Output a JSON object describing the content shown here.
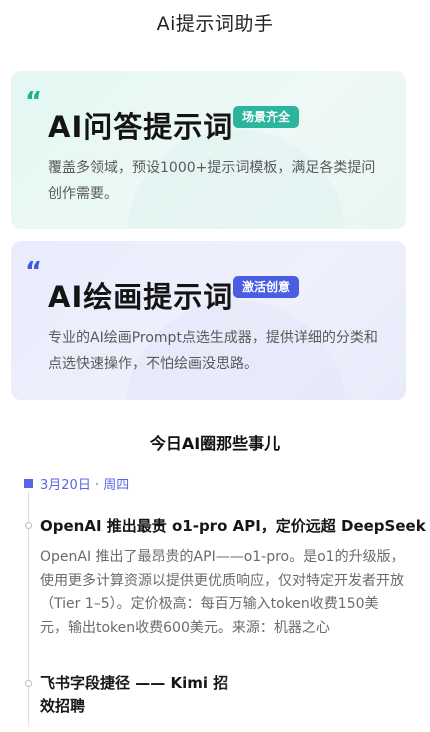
{
  "header": {
    "title": "Ai提示词助手"
  },
  "cards": [
    {
      "title": "AI问答提示词",
      "badge": "场景齐全",
      "description": "覆盖多领域，预设1000+提示词模板，满足各类提问创作需要。"
    },
    {
      "title": "AI绘画提示词",
      "badge": "激活创意",
      "description": "专业的AI绘画Prompt点选生成器，提供详细的分类和点选快速操作，不怕绘画没思路。"
    }
  ],
  "news": {
    "section_title": "今日AI圈那些事儿",
    "date": "3月20日 · 周四",
    "items": [
      {
        "title": "OpenAI 推出最贵 o1-pro API，定价远超 DeepSeek",
        "body": "OpenAI 推出了最昂贵的API——o1-pro。是o1的升级版，使用更多计算资源以提供更优质响应，仅对特定开发者开放（Tier 1–5）。定价极高：每百万输入token收费150美元，输出token收费600美元。来源：机器之心"
      },
      {
        "title_line1": "飞书字段捷径 —— Kimi 招",
        "title_line2": "效招聘"
      }
    ]
  }
}
